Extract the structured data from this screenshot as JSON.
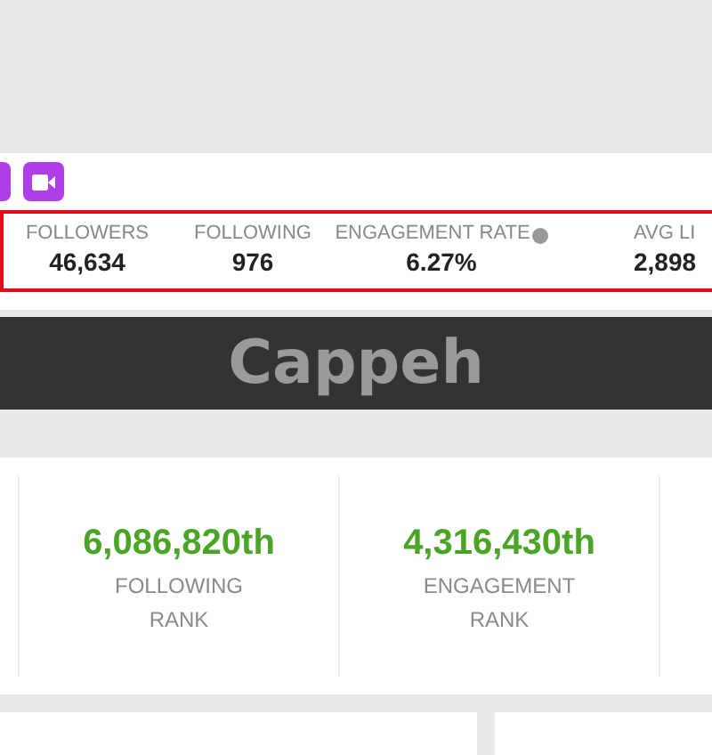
{
  "social_icons": [
    {
      "kind": "square"
    },
    {
      "kind": "video"
    }
  ],
  "stats": [
    {
      "label": "FOLLOWERS",
      "value": "46,634",
      "help": false
    },
    {
      "label": "FOLLOWING",
      "value": "976",
      "help": false
    },
    {
      "label": "ENGAGEMENT RATE",
      "value": "6.27%",
      "help": true
    },
    {
      "label": "AVG LI",
      "value": "2,898",
      "help": false
    }
  ],
  "banner": {
    "title": "Cappeh"
  },
  "ranks": [
    {
      "value": "6,086,820th",
      "label_lines": [
        "FOLLOWING",
        "RANK"
      ]
    },
    {
      "value": "4,316,430th",
      "label_lines": [
        "ENGAGEMENT",
        "RANK"
      ]
    }
  ]
}
